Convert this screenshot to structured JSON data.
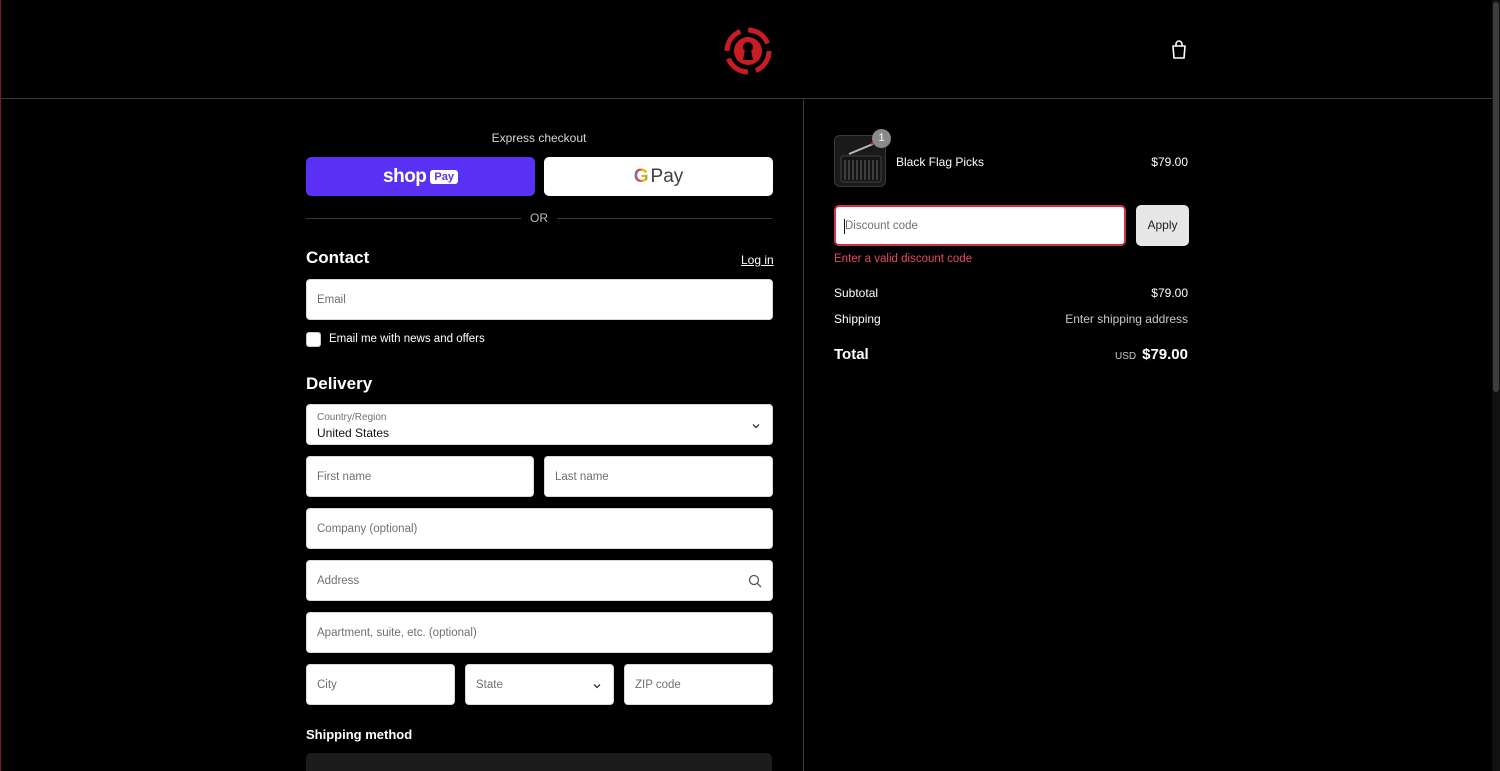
{
  "colors": {
    "accent_error": "#e54a63",
    "shop_pay": "#5a31f4",
    "logo_red": "#c91d25"
  },
  "header": {
    "logo": "keyhole-logo-icon",
    "cart_icon": "shopping-bag-icon"
  },
  "express": {
    "title": "Express checkout",
    "shop_pay_wordmark": "shop",
    "shop_pay_badge": "Pay",
    "gpay_g": "G",
    "gpay_label": "Pay",
    "or_label": "OR"
  },
  "contact": {
    "heading": "Contact",
    "login_link": "Log in",
    "email_placeholder": "Email",
    "newsletter_label": "Email me with news and offers"
  },
  "delivery": {
    "heading": "Delivery",
    "country_label": "Country/Region",
    "country_value": "United States",
    "first_name_placeholder": "First name",
    "last_name_placeholder": "Last name",
    "company_placeholder": "Company (optional)",
    "address_placeholder": "Address",
    "apartment_placeholder": "Apartment, suite, etc. (optional)",
    "city_placeholder": "City",
    "state_placeholder": "State",
    "zip_placeholder": "ZIP code"
  },
  "shipping_method": {
    "heading": "Shipping method"
  },
  "order": {
    "item": {
      "name": "Black Flag Picks",
      "price": "$79.00",
      "quantity": "1"
    },
    "discount_placeholder": "Discount code",
    "apply_label": "Apply",
    "discount_error": "Enter a valid discount code",
    "subtotal_label": "Subtotal",
    "subtotal_value": "$79.00",
    "shipping_label": "Shipping",
    "shipping_value": "Enter shipping address",
    "total_label": "Total",
    "total_currency": "USD",
    "total_value": "$79.00"
  }
}
